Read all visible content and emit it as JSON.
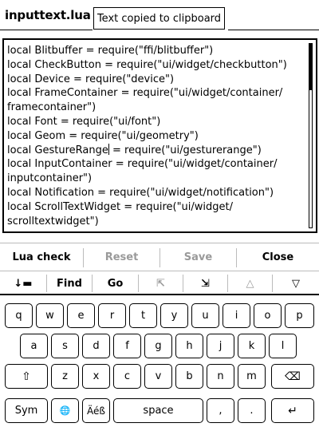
{
  "title": "inputtext.lua",
  "notification": "Text copied to clipboard",
  "editor": {
    "lines": [
      "local Blitbuffer = require(\"ffi/blitbuffer\")",
      "local CheckButton = require(\"ui/widget/checkbutton\")",
      "local Device = require(\"device\")",
      "local FrameContainer = require(\"ui/widget/container/",
      "framecontainer\")",
      "local Font = require(\"ui/font\")",
      "local Geom = require(\"ui/geometry\")",
      "local GestureRange",
      "local InputContainer = require(\"ui/widget/container/",
      "inputcontainer\")",
      "local Notification = require(\"ui/widget/notification\")",
      "local ScrollTextWidget = require(\"ui/widget/",
      "scrolltextwidget\")"
    ],
    "caret_line_rest": " = require(\"ui/gesturerange\")",
    "scroll_position_fraction": 0.25
  },
  "actions": {
    "lua_check": "Lua check",
    "reset": "Reset",
    "save": "Save",
    "close": "Close"
  },
  "nav": {
    "keyboard_toggle": "↓▬",
    "find": "Find",
    "go": "Go",
    "top_left": "⇱",
    "bottom_right": "⇲",
    "up": "△",
    "down": "▽"
  },
  "keyboard": {
    "row1": [
      "q",
      "w",
      "e",
      "r",
      "t",
      "y",
      "u",
      "i",
      "o",
      "p"
    ],
    "row2": [
      "a",
      "s",
      "d",
      "f",
      "g",
      "h",
      "j",
      "k",
      "l"
    ],
    "shift": "⇧",
    "row3": [
      "z",
      "x",
      "c",
      "v",
      "b",
      "n",
      "m"
    ],
    "backspace": "⌫",
    "sym": "Sym",
    "globe": "🌐",
    "accents": "Äéß",
    "space": "space",
    "comma": ",",
    "period": ".",
    "enter": "↵"
  },
  "colors": {
    "border": "#000000",
    "disabled_text": "#9a9a9a",
    "separator": "#bbbbbb"
  }
}
